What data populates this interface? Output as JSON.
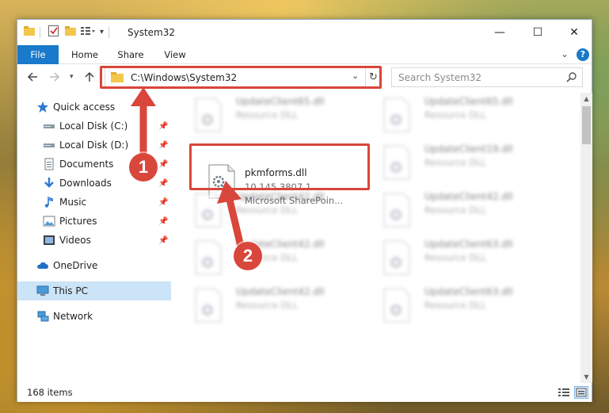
{
  "window": {
    "title": "System32",
    "controls": {
      "minimize": "—",
      "maximize": "☐",
      "close": "✕"
    }
  },
  "ribbon": {
    "tabs": [
      "File",
      "Home",
      "Share",
      "View"
    ]
  },
  "address": {
    "path": "C:\\Windows\\System32",
    "search_placeholder": "Search System32"
  },
  "nav": {
    "items": [
      {
        "label": "Quick access",
        "icon": "star-icon"
      },
      {
        "label": "Local Disk (C:)",
        "icon": "drive-icon",
        "pinned": true
      },
      {
        "label": "Local Disk (D:)",
        "icon": "drive-icon",
        "pinned": true
      },
      {
        "label": "Documents",
        "icon": "documents-icon",
        "pinned": true
      },
      {
        "label": "Downloads",
        "icon": "download-icon",
        "pinned": true
      },
      {
        "label": "Music",
        "icon": "music-icon",
        "pinned": true
      },
      {
        "label": "Pictures",
        "icon": "pictures-icon",
        "pinned": true
      },
      {
        "label": "Videos",
        "icon": "videos-icon",
        "pinned": true
      },
      {
        "label": "OneDrive",
        "icon": "cloud-icon"
      },
      {
        "label": "This PC",
        "icon": "monitor-icon",
        "selected": true
      },
      {
        "label": "Network",
        "icon": "network-icon"
      }
    ]
  },
  "files": [
    {
      "name": "UpdateClient65.dll",
      "desc": "Resource DLL"
    },
    {
      "name": "UpdateClient65.dll",
      "desc": "Resource DLL"
    },
    {
      "name": "pkmforms.dll",
      "desc": "10.145.3807.1",
      "desc2": "Microsoft SharePoin..."
    },
    {
      "name": "UpdateClient19.dll",
      "desc": "Resource DLL"
    },
    {
      "name": "UpdateClient42.dll",
      "desc": "Resource DLL"
    },
    {
      "name": "UpdateClient42.dll",
      "desc": "Resource DLL"
    },
    {
      "name": "UpdateClient42.dll",
      "desc": "Resource DLL"
    },
    {
      "name": "UpdateClient63.dll",
      "desc": "Resource DLL"
    },
    {
      "name": "UpdateClient42.dll",
      "desc": "Resource DLL"
    },
    {
      "name": "UpdateClient63.dll",
      "desc": "Resource DLL"
    }
  ],
  "status": {
    "item_count": "168 items"
  },
  "annotations": {
    "marker1": "1",
    "marker2": "2",
    "color": "#d9463b"
  },
  "colors": {
    "accent": "#1979ca",
    "selection": "#cce4f7"
  }
}
